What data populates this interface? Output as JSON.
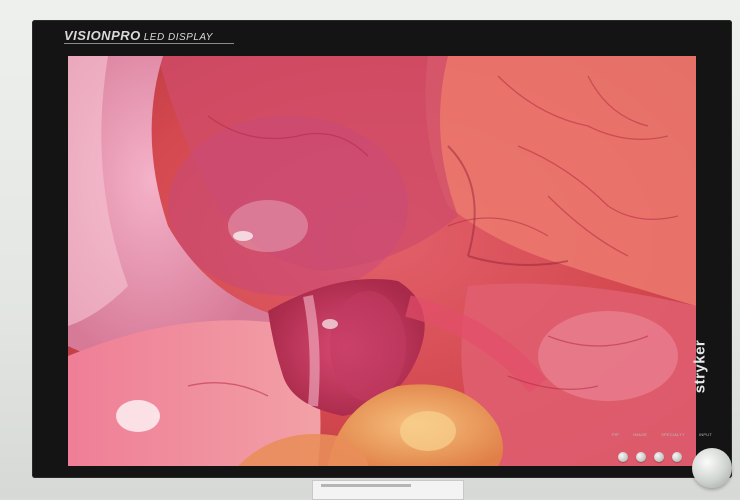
{
  "monitor": {
    "brand_main": "VISIONPRO",
    "brand_sub": "LED DISPLAY",
    "manufacturer": "stryker",
    "button_labels": [
      "PIP",
      "IMAGE",
      "SPECIALTY",
      "INPUT"
    ]
  },
  "colors": {
    "bezel": "#141414",
    "housing": "#e3e6e3",
    "tissue_red": "#d04a4e",
    "tissue_pink": "#f08aa0",
    "tissue_orange": "#f0a070"
  },
  "icons": {
    "front_buttons": [
      "round-button-icon",
      "round-button-icon",
      "round-button-icon",
      "round-button-icon"
    ],
    "knob": "rotary-knob-icon"
  }
}
